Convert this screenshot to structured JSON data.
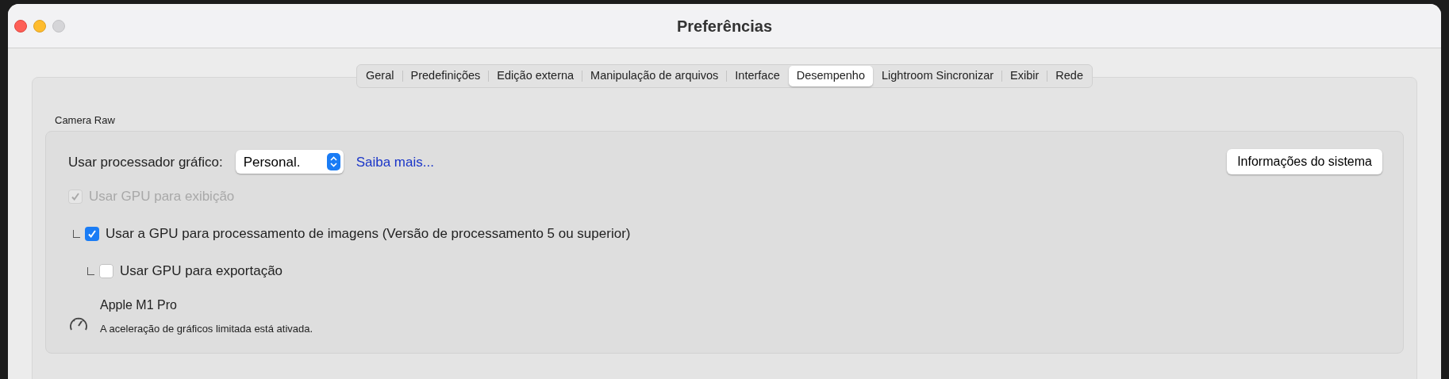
{
  "window": {
    "title": "Preferências"
  },
  "tabs": [
    {
      "label": "Geral",
      "selected": false
    },
    {
      "label": "Predefinições",
      "selected": false
    },
    {
      "label": "Edição externa",
      "selected": false
    },
    {
      "label": "Manipulação de arquivos",
      "selected": false
    },
    {
      "label": "Interface",
      "selected": false
    },
    {
      "label": "Desempenho",
      "selected": true
    },
    {
      "label": "Lightroom Sincronizar",
      "selected": false
    },
    {
      "label": "Exibir",
      "selected": false
    },
    {
      "label": "Rede",
      "selected": false
    }
  ],
  "section": {
    "title": "Camera Raw",
    "gpu_select": {
      "label": "Usar processador gráfico:",
      "value": "Personal.",
      "link": "Saiba mais..."
    },
    "system_info_button": "Informações do sistema",
    "options": [
      {
        "label": "Usar GPU para exibição",
        "checked": true,
        "disabled": true,
        "children": [
          {
            "label": "Usar a GPU para processamento de imagens (Versão de processamento 5 ou superior)",
            "checked": true,
            "disabled": false,
            "children": [
              {
                "label": "Usar GPU para exportação",
                "checked": false,
                "disabled": false
              }
            ]
          }
        ]
      }
    ],
    "gpu_info": {
      "name": "Apple M1 Pro",
      "status": "A aceleração de gráficos limitada está ativada."
    }
  }
}
